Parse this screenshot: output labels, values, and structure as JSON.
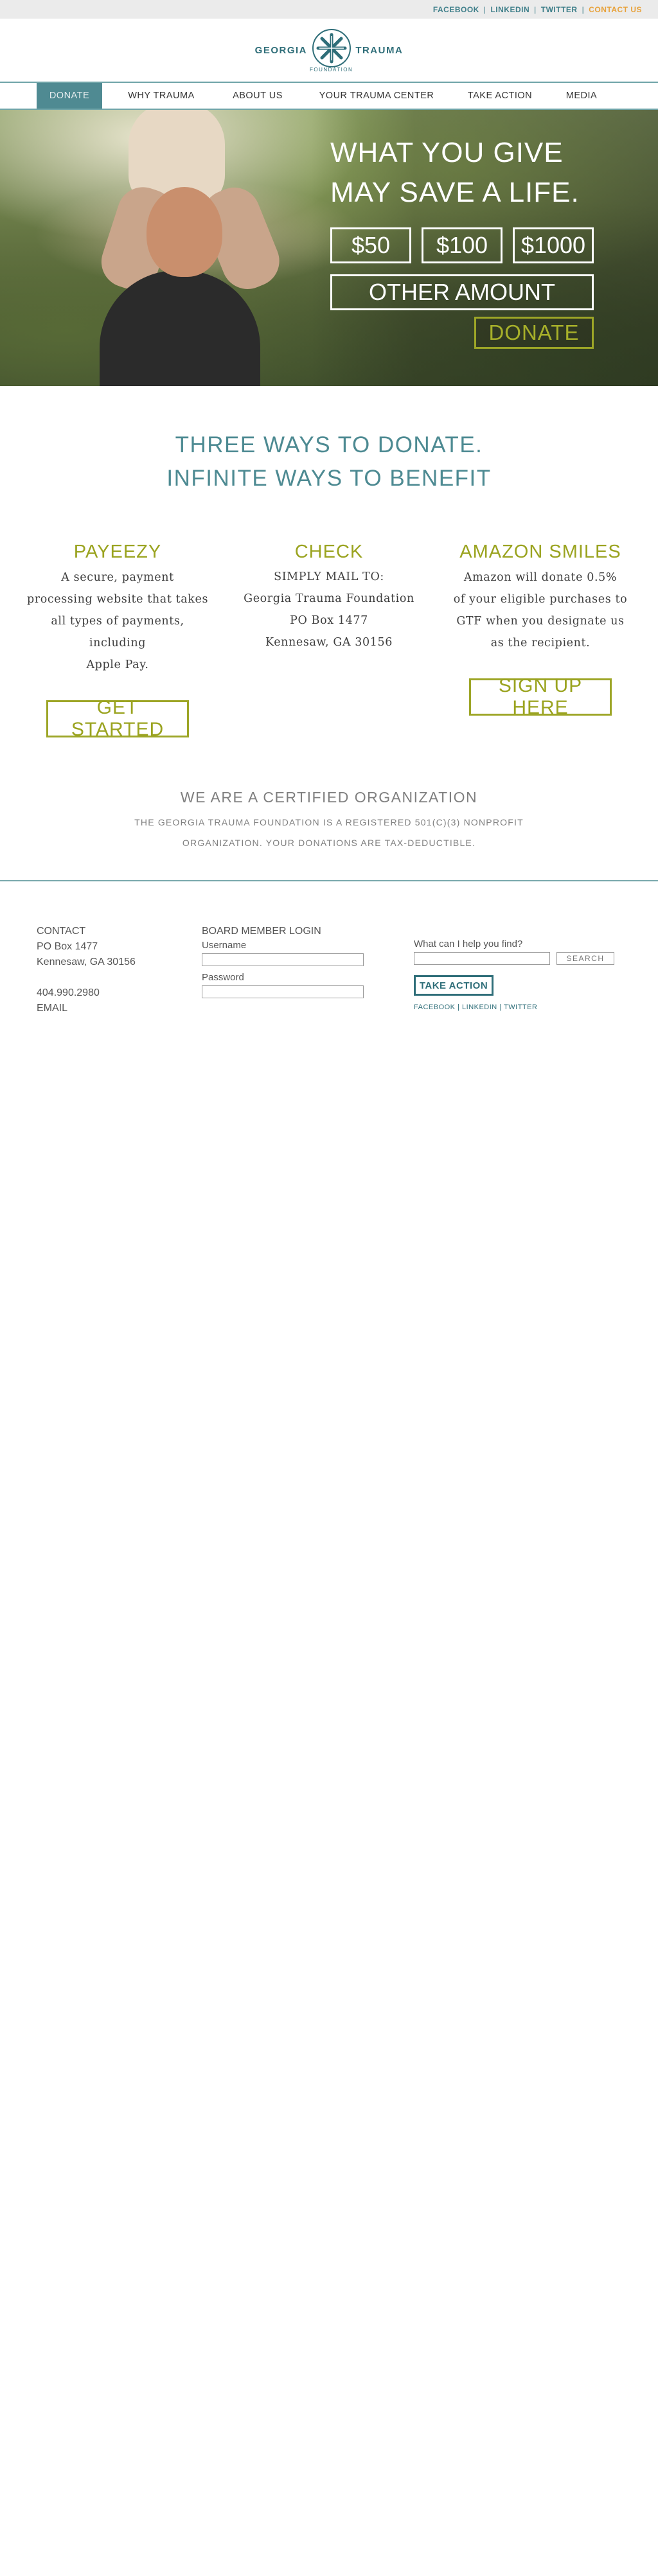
{
  "topbar": {
    "links": [
      "FACEBOOK",
      "LINKEDIN",
      "TWITTER"
    ],
    "contact": "CONTACT US",
    "separator": "|"
  },
  "logo": {
    "left_word": "GEORGIA",
    "right_word": "TRAUMA",
    "sub_word": "FOUNDATION",
    "icon": "asterisk-cross-icon",
    "color": "#2f6e79"
  },
  "nav": {
    "items": [
      "DONATE",
      "WHY TRAUMA",
      "ABOUT US",
      "YOUR TRAUMA CENTER",
      "TAKE ACTION",
      "MEDIA"
    ],
    "active_index": 0,
    "active_color": "#4f8a92"
  },
  "hero": {
    "title_line1": "WHAT YOU GIVE",
    "title_line2": "MAY SAVE A LIFE.",
    "amounts": [
      "$50",
      "$100",
      "$1000"
    ],
    "other": "OTHER AMOUNT",
    "donate": "DONATE",
    "accent": "#9da627"
  },
  "ways": {
    "heading_line1": "THREE WAYS TO DONATE.",
    "heading_line2": "INFINITE WAYS TO BENEFIT",
    "columns": [
      {
        "title": "PAYEEZY",
        "text": "A secure, payment\nprocessing website that takes\nall types of payments, including\nApple Pay.",
        "button": "GET STARTED"
      },
      {
        "title": "CHECK",
        "text": "SIMPLY MAIL TO:\nGeorgia Trauma Foundation\nPO Box 1477\nKennesaw, GA 30156",
        "button": ""
      },
      {
        "title": "AMAZON SMILES",
        "text": "Amazon will donate 0.5%\nof your eligible purchases to\nGTF when you designate us\nas the recipient.",
        "button": "SIGN UP HERE"
      }
    ]
  },
  "certified": {
    "heading": "WE ARE A CERTIFIED ORGANIZATION",
    "line1": "THE GEORGIA TRAUMA FOUNDATION IS A REGISTERED 501(C)(3) NONPROFIT",
    "line2": "ORGANIZATION. YOUR DONATIONS ARE TAX-DEDUCTIBLE."
  },
  "footer": {
    "contact": {
      "title": "CONTACT",
      "address1": "PO Box 1477",
      "address2": "Kennesaw, GA 30156",
      "phone": "404.990.2980",
      "email": "EMAIL"
    },
    "login": {
      "title": "BOARD MEMBER LOGIN",
      "username_label": "Username",
      "password_label": "Password"
    },
    "search": {
      "label": "What can I help you find?",
      "button": "SEARCH",
      "take_action": "TAKE ACTION",
      "social": [
        "FACEBOOK",
        "LINKEDIN",
        "TWITTER"
      ]
    }
  }
}
